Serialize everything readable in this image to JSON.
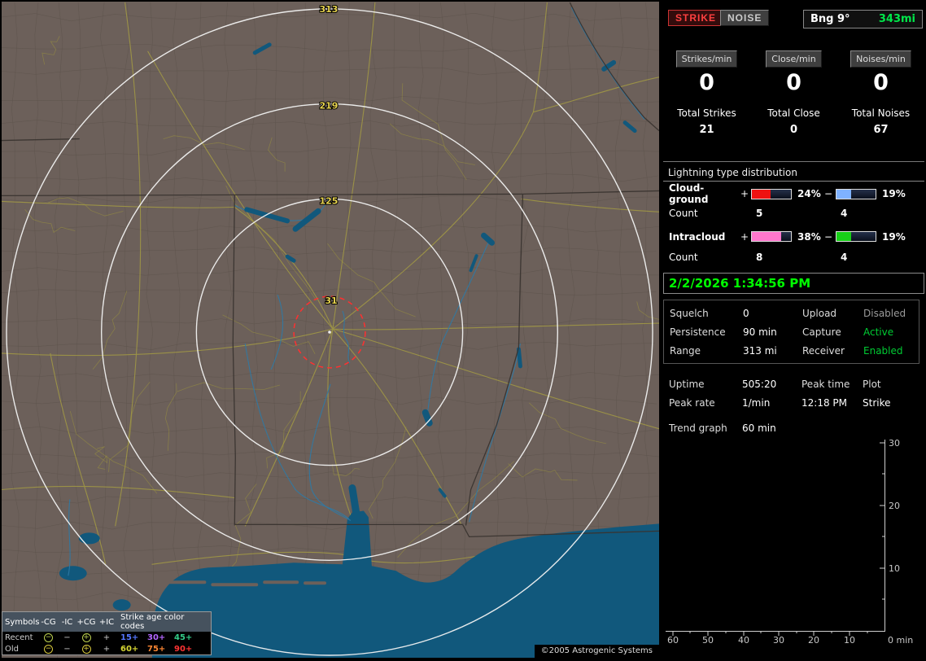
{
  "map": {
    "ring_labels": {
      "r313": "313",
      "r219": "219",
      "r125": "125",
      "r31": "31"
    },
    "copyright": "©2005 Astrogenic Systems",
    "legend": {
      "symbols_header": "Symbols",
      "col_neg_cg": "-CG",
      "col_neg_ic": "-IC",
      "col_pos_cg": "+CG",
      "col_pos_ic": "+IC",
      "age_header": "Strike age color codes",
      "recent_label": "Recent",
      "old_label": "Old",
      "symbols": {
        "neg_cg": "−",
        "neg_ic": "−",
        "pos_cg": "+",
        "pos_ic": "+"
      },
      "recent_ages": [
        {
          "label": "15+",
          "color": "#5577ff"
        },
        {
          "label": "30+",
          "color": "#b366ff"
        },
        {
          "label": "45+",
          "color": "#33cc88"
        }
      ],
      "old_ages": [
        {
          "label": "60+",
          "color": "#d6d633"
        },
        {
          "label": "75+",
          "color": "#ff8833"
        },
        {
          "label": "90+",
          "color": "#ff3333"
        }
      ]
    }
  },
  "panel": {
    "strike_button": "STRIKE",
    "noise_button": "NOISE",
    "bearing": {
      "label": "Bng 9°",
      "range": "343mi"
    },
    "rates": {
      "strikes": {
        "label": "Strikes/min",
        "value": "0"
      },
      "close": {
        "label": "Close/min",
        "value": "0"
      },
      "noises": {
        "label": "Noises/min",
        "value": "0"
      }
    },
    "totals": {
      "strikes": {
        "label": "Total Strikes",
        "value": "21"
      },
      "close": {
        "label": "Total Close",
        "value": "0"
      },
      "noises": {
        "label": "Total Noises",
        "value": "67"
      }
    },
    "distribution": {
      "title": "Lightning type distribution",
      "cloud_ground": {
        "name": "Cloud-ground",
        "plus_sign": "+",
        "plus_pct": "24%",
        "plus_color": "#ee1111",
        "minus_sign": "−",
        "minus_pct": "19%",
        "minus_color": "#7fb2ff"
      },
      "cg_count": {
        "label": "Count",
        "plus": "5",
        "minus": "4"
      },
      "intracloud": {
        "name": "Intracloud",
        "plus_sign": "+",
        "plus_pct": "38%",
        "plus_color": "#ff77cc",
        "minus_sign": "−",
        "minus_pct": "19%",
        "minus_color": "#18d018"
      },
      "ic_count": {
        "label": "Count",
        "plus": "8",
        "minus": "4"
      }
    },
    "datetime": "2/2/2026 1:34:56 PM",
    "status": {
      "squelch_label": "Squelch",
      "squelch_value": "0",
      "upload_label": "Upload",
      "upload_value": "Disabled",
      "persistence_label": "Persistence",
      "persistence_value": "90 min",
      "capture_label": "Capture",
      "capture_value": "Active",
      "range_label": "Range",
      "range_value": "313 mi",
      "receiver_label": "Receiver",
      "receiver_value": "Enabled"
    },
    "stats": {
      "uptime_label": "Uptime",
      "uptime_value": "505:20",
      "peak_time_label": "Peak time",
      "peak_time_value": "12:18 PM",
      "plot_label": "Plot",
      "plot_value": "Strike",
      "peak_rate_label": "Peak rate",
      "peak_rate_value": "1/min",
      "trend_label": "Trend graph",
      "trend_value": "60 min"
    },
    "trend_axes": {
      "y_ticks": [
        "30",
        "20",
        "10"
      ],
      "x_ticks": [
        "60",
        "50",
        "40",
        "30",
        "20",
        "10"
      ],
      "origin_label": "0 min"
    }
  }
}
